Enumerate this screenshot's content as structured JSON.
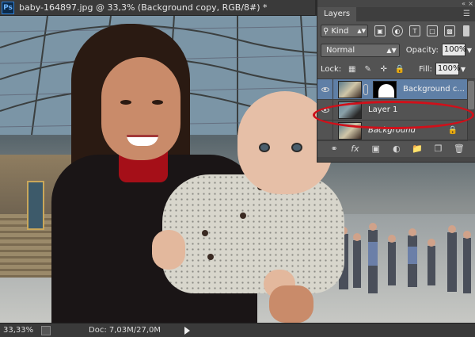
{
  "document": {
    "title": "baby-164897.jpg @ 33,3% (Background copy, RGB/8#) *",
    "app_badge": "Ps"
  },
  "status_bar": {
    "zoom": "33,33%",
    "doc_size": "Doc: 7,03M/27,0M"
  },
  "layers_panel": {
    "tab_label": "Layers",
    "filter_kind": "Kind",
    "blend_mode": "Normal",
    "opacity_label": "Opacity:",
    "opacity_value": "100%",
    "lock_label": "Lock:",
    "fill_label": "Fill:",
    "fill_value": "100%",
    "layers": [
      {
        "name": "Background c...",
        "active": true,
        "has_mask": true,
        "visible": true
      },
      {
        "name": "Layer 1",
        "active": false,
        "has_mask": false,
        "visible": true
      },
      {
        "name": "Background",
        "active": false,
        "has_mask": false,
        "visible": false,
        "locked": true
      }
    ]
  },
  "colors": {
    "active_layer": "#5f7fa6",
    "annotation": "#d0101a",
    "panel_bg": "#535353"
  }
}
